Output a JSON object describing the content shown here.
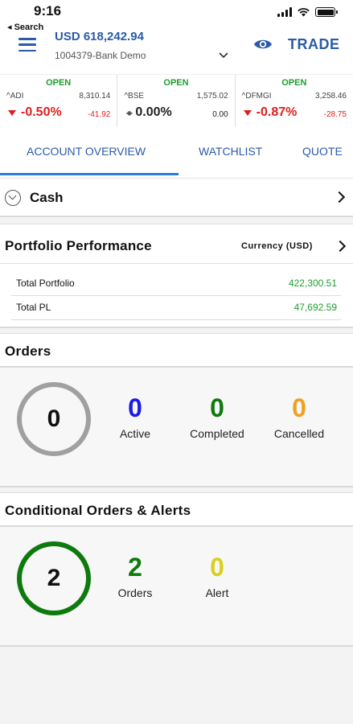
{
  "status_bar": {
    "time": "9:16",
    "back_label": "◂ Search"
  },
  "header": {
    "balance": "USD 618,242.94",
    "account": "1004379-Bank Demo",
    "trade_label": "TRADE"
  },
  "tickers": [
    {
      "status": "OPEN",
      "symbol": "^ADI",
      "value": "8,310.14",
      "pct": "-0.50%",
      "change": "-41.92",
      "direction": "down"
    },
    {
      "status": "OPEN",
      "symbol": "^BSE",
      "value": "1,575.02",
      "pct": "0.00%",
      "change": "0.00",
      "direction": "flat"
    },
    {
      "status": "OPEN",
      "symbol": "^DFMGI",
      "value": "3,258.46",
      "pct": "-0.87%",
      "change": "-28.75",
      "direction": "down"
    }
  ],
  "tabs": [
    {
      "label": "ACCOUNT OVERVIEW",
      "active": true
    },
    {
      "label": "WATCHLIST",
      "active": false
    },
    {
      "label": "QUOTE",
      "active": false
    }
  ],
  "cash": {
    "label": "Cash"
  },
  "portfolio": {
    "title": "Portfolio Performance",
    "currency": "Currency (USD)",
    "rows": [
      {
        "label": "Total Portfolio",
        "value": "422,300.51"
      },
      {
        "label": "Total PL",
        "value": "47,692.59"
      }
    ]
  },
  "orders": {
    "title": "Orders",
    "total": "0",
    "stats": [
      {
        "value": "0",
        "label": "Active",
        "color": "#1a1ae6"
      },
      {
        "value": "0",
        "label": "Completed",
        "color": "#0e7a0e"
      },
      {
        "value": "0",
        "label": "Cancelled",
        "color": "#f0a020"
      }
    ]
  },
  "conditional": {
    "title": "Conditional Orders & Alerts",
    "total": "2",
    "stats": [
      {
        "value": "2",
        "label": "Orders",
        "color": "#0e7a0e"
      },
      {
        "value": "0",
        "label": "Alert",
        "color": "#d8d020"
      }
    ]
  },
  "colors": {
    "accent": "#2a5aa8",
    "positive": "#1e9e2e",
    "negative": "#e01e1e",
    "orders_ring": "#a0a0a0",
    "conditional_ring": "#0e7a0e"
  }
}
